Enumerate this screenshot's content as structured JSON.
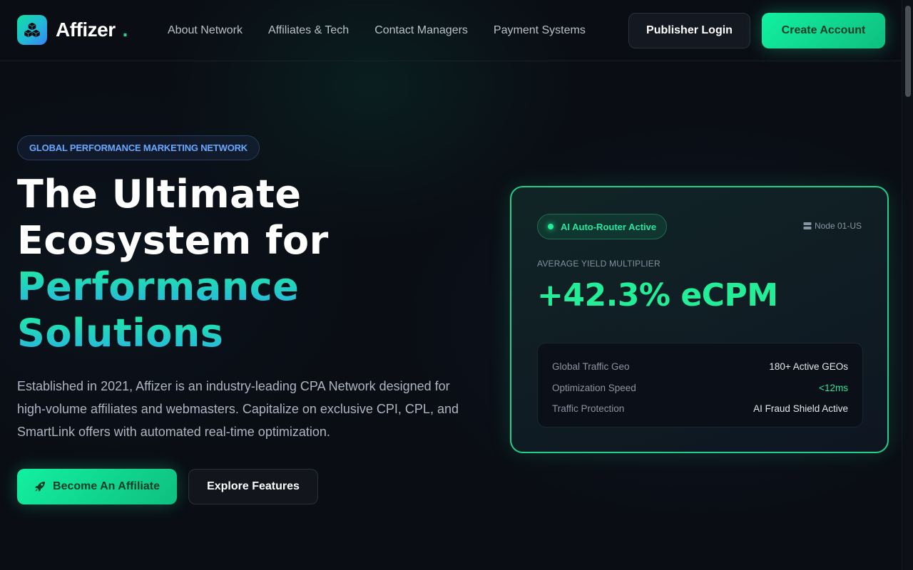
{
  "header": {
    "brand": "Affizer",
    "brand_dot": ".",
    "nav": [
      "About Network",
      "Affiliates & Tech",
      "Contact Managers",
      "Payment Systems"
    ],
    "login_label": "Publisher Login",
    "create_label": "Create Account"
  },
  "hero": {
    "badge": "GLOBAL PERFORMANCE MARKETING NETWORK",
    "title_line1": "The Ultimate",
    "title_line2": "Ecosystem for",
    "title_line3": "Performance",
    "title_line4": "Solutions",
    "description": "Established in 2021, Affizer is an industry-leading CPA Network designed for high-volume affiliates and webmasters. Capitalize on exclusive CPI, CPL, and SmartLink offers with automated real-time optimization.",
    "primary_button": "Become An Affiliate",
    "secondary_button": "Explore Features"
  },
  "card": {
    "status": "AI Auto-Router Active",
    "node": "Node 01-US",
    "yield_label": "AVERAGE YIELD MULTIPLIER",
    "yield_value": "+42.3% eCPM",
    "stats": [
      {
        "label": "Global Traffic Geo",
        "value": "180+ Active GEOs"
      },
      {
        "label": "Optimization Speed",
        "value": "<12ms"
      },
      {
        "label": "Traffic Protection",
        "value": "AI Fraud Shield Active"
      }
    ]
  },
  "colors": {
    "accent_green": "#12f0a0",
    "accent_blue": "#6aa8ff",
    "background": "#0a0d14"
  }
}
